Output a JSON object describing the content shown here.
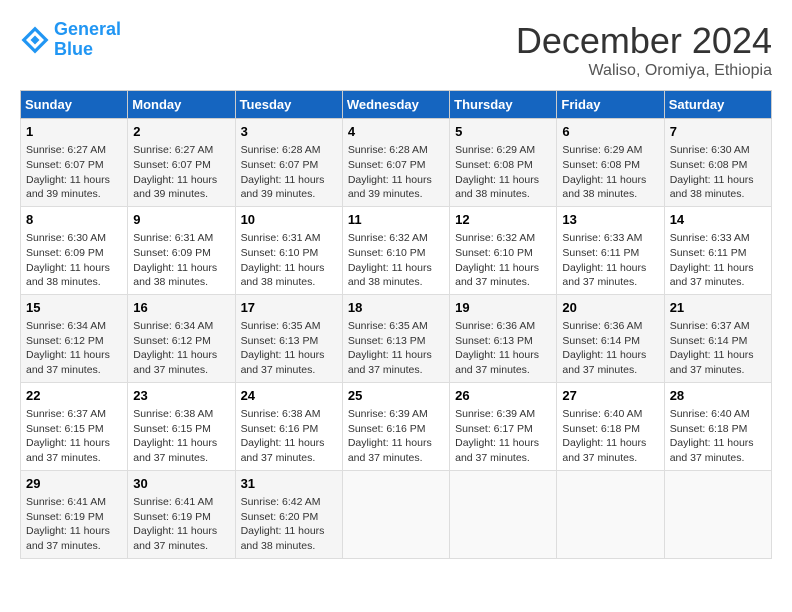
{
  "header": {
    "logo_line1": "General",
    "logo_line2": "Blue",
    "month": "December 2024",
    "location": "Waliso, Oromiya, Ethiopia"
  },
  "days_of_week": [
    "Sunday",
    "Monday",
    "Tuesday",
    "Wednesday",
    "Thursday",
    "Friday",
    "Saturday"
  ],
  "weeks": [
    [
      {
        "num": "1",
        "info": "Sunrise: 6:27 AM\nSunset: 6:07 PM\nDaylight: 11 hours\nand 39 minutes."
      },
      {
        "num": "2",
        "info": "Sunrise: 6:27 AM\nSunset: 6:07 PM\nDaylight: 11 hours\nand 39 minutes."
      },
      {
        "num": "3",
        "info": "Sunrise: 6:28 AM\nSunset: 6:07 PM\nDaylight: 11 hours\nand 39 minutes."
      },
      {
        "num": "4",
        "info": "Sunrise: 6:28 AM\nSunset: 6:07 PM\nDaylight: 11 hours\nand 39 minutes."
      },
      {
        "num": "5",
        "info": "Sunrise: 6:29 AM\nSunset: 6:08 PM\nDaylight: 11 hours\nand 38 minutes."
      },
      {
        "num": "6",
        "info": "Sunrise: 6:29 AM\nSunset: 6:08 PM\nDaylight: 11 hours\nand 38 minutes."
      },
      {
        "num": "7",
        "info": "Sunrise: 6:30 AM\nSunset: 6:08 PM\nDaylight: 11 hours\nand 38 minutes."
      }
    ],
    [
      {
        "num": "8",
        "info": "Sunrise: 6:30 AM\nSunset: 6:09 PM\nDaylight: 11 hours\nand 38 minutes."
      },
      {
        "num": "9",
        "info": "Sunrise: 6:31 AM\nSunset: 6:09 PM\nDaylight: 11 hours\nand 38 minutes."
      },
      {
        "num": "10",
        "info": "Sunrise: 6:31 AM\nSunset: 6:10 PM\nDaylight: 11 hours\nand 38 minutes."
      },
      {
        "num": "11",
        "info": "Sunrise: 6:32 AM\nSunset: 6:10 PM\nDaylight: 11 hours\nand 38 minutes."
      },
      {
        "num": "12",
        "info": "Sunrise: 6:32 AM\nSunset: 6:10 PM\nDaylight: 11 hours\nand 37 minutes."
      },
      {
        "num": "13",
        "info": "Sunrise: 6:33 AM\nSunset: 6:11 PM\nDaylight: 11 hours\nand 37 minutes."
      },
      {
        "num": "14",
        "info": "Sunrise: 6:33 AM\nSunset: 6:11 PM\nDaylight: 11 hours\nand 37 minutes."
      }
    ],
    [
      {
        "num": "15",
        "info": "Sunrise: 6:34 AM\nSunset: 6:12 PM\nDaylight: 11 hours\nand 37 minutes."
      },
      {
        "num": "16",
        "info": "Sunrise: 6:34 AM\nSunset: 6:12 PM\nDaylight: 11 hours\nand 37 minutes."
      },
      {
        "num": "17",
        "info": "Sunrise: 6:35 AM\nSunset: 6:13 PM\nDaylight: 11 hours\nand 37 minutes."
      },
      {
        "num": "18",
        "info": "Sunrise: 6:35 AM\nSunset: 6:13 PM\nDaylight: 11 hours\nand 37 minutes."
      },
      {
        "num": "19",
        "info": "Sunrise: 6:36 AM\nSunset: 6:13 PM\nDaylight: 11 hours\nand 37 minutes."
      },
      {
        "num": "20",
        "info": "Sunrise: 6:36 AM\nSunset: 6:14 PM\nDaylight: 11 hours\nand 37 minutes."
      },
      {
        "num": "21",
        "info": "Sunrise: 6:37 AM\nSunset: 6:14 PM\nDaylight: 11 hours\nand 37 minutes."
      }
    ],
    [
      {
        "num": "22",
        "info": "Sunrise: 6:37 AM\nSunset: 6:15 PM\nDaylight: 11 hours\nand 37 minutes."
      },
      {
        "num": "23",
        "info": "Sunrise: 6:38 AM\nSunset: 6:15 PM\nDaylight: 11 hours\nand 37 minutes."
      },
      {
        "num": "24",
        "info": "Sunrise: 6:38 AM\nSunset: 6:16 PM\nDaylight: 11 hours\nand 37 minutes."
      },
      {
        "num": "25",
        "info": "Sunrise: 6:39 AM\nSunset: 6:16 PM\nDaylight: 11 hours\nand 37 minutes."
      },
      {
        "num": "26",
        "info": "Sunrise: 6:39 AM\nSunset: 6:17 PM\nDaylight: 11 hours\nand 37 minutes."
      },
      {
        "num": "27",
        "info": "Sunrise: 6:40 AM\nSunset: 6:18 PM\nDaylight: 11 hours\nand 37 minutes."
      },
      {
        "num": "28",
        "info": "Sunrise: 6:40 AM\nSunset: 6:18 PM\nDaylight: 11 hours\nand 37 minutes."
      }
    ],
    [
      {
        "num": "29",
        "info": "Sunrise: 6:41 AM\nSunset: 6:19 PM\nDaylight: 11 hours\nand 37 minutes."
      },
      {
        "num": "30",
        "info": "Sunrise: 6:41 AM\nSunset: 6:19 PM\nDaylight: 11 hours\nand 37 minutes."
      },
      {
        "num": "31",
        "info": "Sunrise: 6:42 AM\nSunset: 6:20 PM\nDaylight: 11 hours\nand 38 minutes."
      },
      {
        "num": "",
        "info": ""
      },
      {
        "num": "",
        "info": ""
      },
      {
        "num": "",
        "info": ""
      },
      {
        "num": "",
        "info": ""
      }
    ]
  ]
}
